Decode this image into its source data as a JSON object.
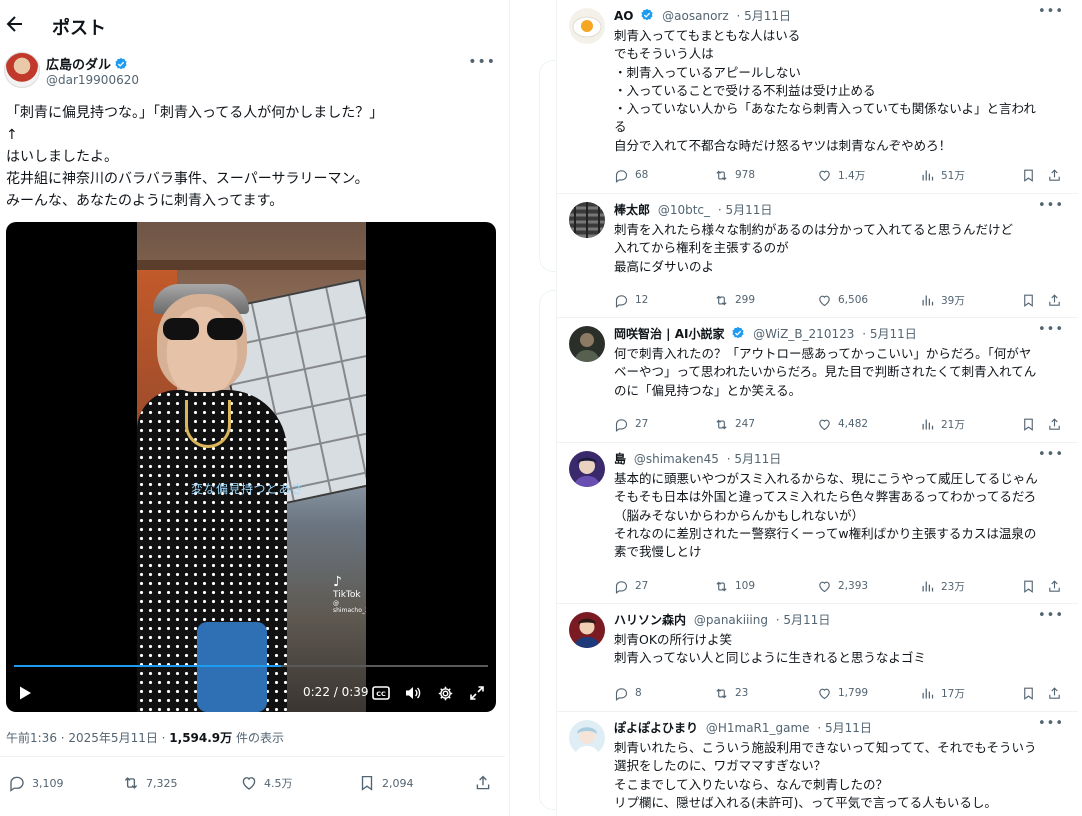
{
  "header": {
    "title": "ポスト"
  },
  "post": {
    "author_name": "広島のダル",
    "author_handle": "@dar19900620",
    "lines": [
      "「刺青に偏見持つな。」「刺青入ってる人が何かしました？」",
      "↑",
      "はいしましたよ。",
      "花井組に神奈川のバラバラ事件、スーパーサラリーマン。",
      "みーんな、あなたのように刺青入ってます。"
    ],
    "video": {
      "caption": "変な偏見持つとあさ",
      "watermark_logo": "TikTok",
      "watermark_user": "@ shimacho_3117",
      "time": "0:22 / 0:39",
      "progress": 0.564
    },
    "timestamp": "午前1:36 · 2025年5月11日 · ",
    "views": "1,594.9万",
    "views_suffix": " 件の表示",
    "stats": {
      "replies": "3,109",
      "reposts": "7,325",
      "likes": "4.5万",
      "bookmarks": "2,094"
    }
  },
  "replies": [
    {
      "name": "AO",
      "verified": true,
      "handle": "@aosanorz",
      "date": "· 5月11日",
      "avatar": "egg",
      "lines": [
        "刺青入っててもまともな人はいる",
        "でもそういう人は",
        "・刺青入っているアピールしない",
        "・入っていることで受ける不利益は受け止める",
        "・入っていない人から「あなたなら刺青入っていても関係ないよ」と言われ",
        "る",
        "自分で入れて不都合な時だけ怒るヤツは刺青なんぞやめろ！"
      ],
      "stats": {
        "replies": "68",
        "reposts": "978",
        "likes": "1.4万",
        "views": "51万"
      }
    },
    {
      "name": "棒太郎",
      "verified": false,
      "handle": "@10btc_",
      "date": "· 5月11日",
      "avatar": "tire",
      "lines": [
        "刺青を入れたら様々な制約があるのは分かって入れてると思うんだけど",
        "入れてから権利を主張するのが",
        "最高にダサいのよ"
      ],
      "stats": {
        "replies": "12",
        "reposts": "299",
        "likes": "6,506",
        "views": "39万"
      }
    },
    {
      "name": "岡咲智治 | AI小説家",
      "verified": true,
      "handle": "@WiZ_B_210123",
      "date": "· 5月11日",
      "avatar": "dark",
      "lines": [
        "何で刺青入れたの？「アウトロー感あってかっこいい」からだろ。「何がヤ",
        "ベーやつ」って思われたいからだろ。見た目で判断されたくて刺青入れてん",
        "のに「偏見持つな」とか笑える。"
      ],
      "stats": {
        "replies": "27",
        "reposts": "247",
        "likes": "4,482",
        "views": "21万"
      }
    },
    {
      "name": "島",
      "verified": false,
      "handle": "@shimaken45",
      "date": "· 5月11日",
      "avatar": "purple",
      "lines": [
        "基本的に頭悪いやつがスミ入れるからな、現にこうやって威圧してるじゃん",
        "そもそも日本は外国と違ってスミ入れたら色々弊害あるってわかってるだろ",
        "（脳みそないからわからんかもしれないが）",
        "それなのに差別されたー警察行くーってw権利ばかり主張するカスは温泉の",
        "素で我慢しとけ"
      ],
      "stats": {
        "replies": "27",
        "reposts": "109",
        "likes": "2,393",
        "views": "23万"
      }
    },
    {
      "name": "ハリソン森内",
      "verified": false,
      "handle": "@panakiiing",
      "date": "· 5月11日",
      "avatar": "crimson",
      "lines": [
        "刺青OKの所行けよ笑",
        "刺青入ってない人と同じように生きれると思うなよゴミ"
      ],
      "stats": {
        "replies": "8",
        "reposts": "23",
        "likes": "1,799",
        "views": "17万"
      }
    },
    {
      "name": "ぽよぽよひまり",
      "verified": false,
      "handle": "@H1maR1_game",
      "date": "· 5月11日",
      "avatar": "anime",
      "lines": [
        "刺青いれたら、こういう施設利用できないって知ってて、それでもそういう",
        "選択をしたのに、ワガママすぎない？",
        "そこまでして入りたいなら、なんで刺青したの？",
        "リプ欄に、隠せば入れる(未許可)、って平気で言ってる人もいるし。"
      ],
      "stats": null
    }
  ],
  "colors": {
    "accent": "#1d9bf0",
    "muted": "#536471",
    "border": "#eff3f4"
  }
}
